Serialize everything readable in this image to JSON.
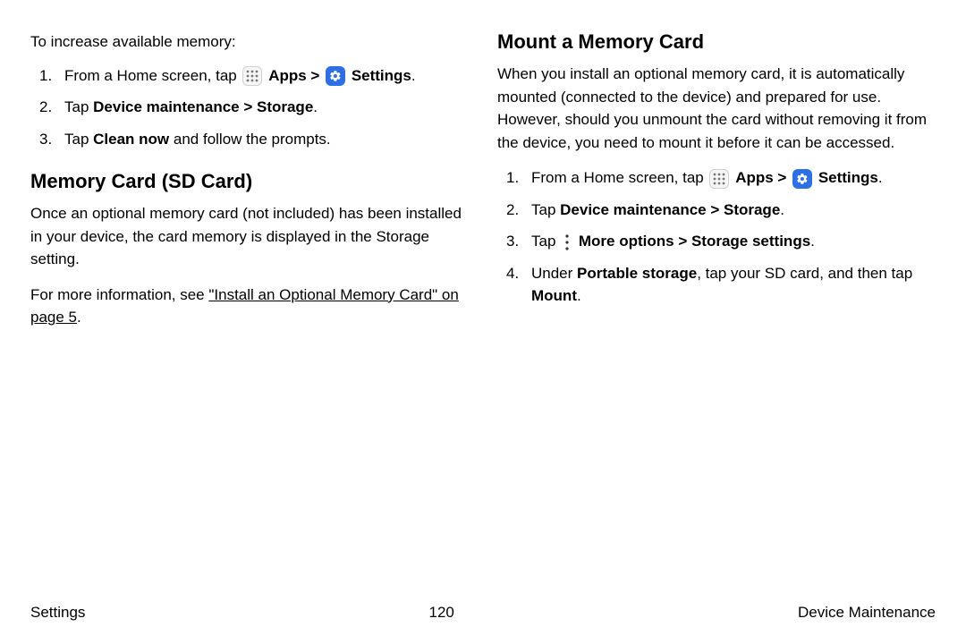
{
  "left": {
    "intro": "To increase available memory:",
    "steps": {
      "s1_a": "From a Home screen, tap ",
      "s1_apps": "Apps",
      "s1_sep": " > ",
      "s1_settings": "Settings",
      "s1_end": ".",
      "s2_a": "Tap ",
      "s2_b": "Device maintenance > Storage",
      "s2_end": ".",
      "s3_a": "Tap ",
      "s3_b": "Clean now",
      "s3_c": " and follow the prompts."
    },
    "h2": "Memory Card (SD Card)",
    "p1": "Once an optional memory card (not included) has been installed in your device, the card memory is displayed in the Storage setting.",
    "p2_a": "For more information, see ",
    "p2_link": "\"Install an Optional Memory Card\" on page 5",
    "p2_end": "."
  },
  "right": {
    "h2": "Mount a Memory Card",
    "p1": "When you install an optional memory card, it is automatically mounted (connected to the device) and prepared for use. However, should you unmount the card without removing it from the device, you need to mount it before it can be accessed.",
    "steps": {
      "s1_a": "From a Home screen, tap ",
      "s1_apps": "Apps",
      "s1_sep": " > ",
      "s1_settings": "Settings",
      "s1_end": ".",
      "s2_a": "Tap ",
      "s2_b": "Device maintenance > Storage",
      "s2_end": ".",
      "s3_a": "Tap ",
      "s3_b": "More options > Storage settings",
      "s3_end": ".",
      "s4_a": "Under ",
      "s4_b": "Portable storage",
      "s4_c": ", tap your SD card, and then tap ",
      "s4_d": "Mount",
      "s4_end": "."
    }
  },
  "footer": {
    "left": "Settings",
    "center": "120",
    "right": "Device Maintenance"
  }
}
